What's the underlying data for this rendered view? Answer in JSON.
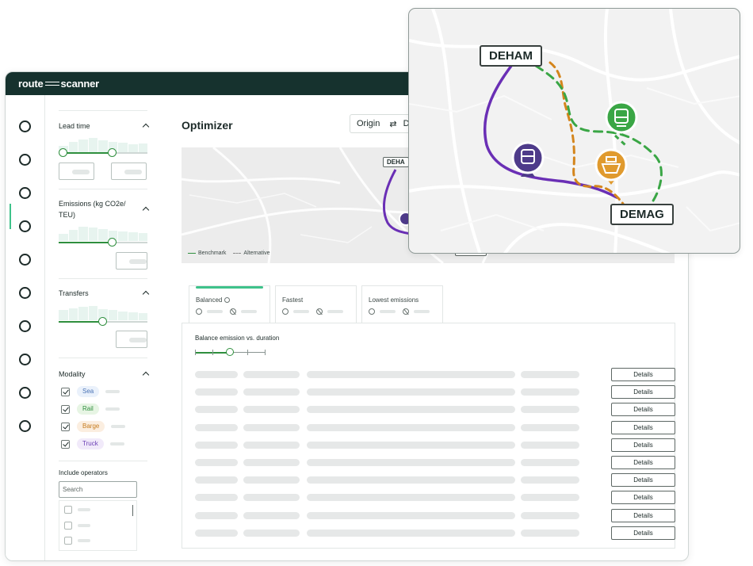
{
  "app": {
    "logo_left": "route",
    "logo_right": "scanner"
  },
  "filters": {
    "lead_time": "Lead time",
    "emissions": "Emissions (kg CO2e/",
    "emissions_line2": "TEU)",
    "transfers": "Transfers",
    "modality": "Modality",
    "modalities": [
      {
        "label": "Sea",
        "checked": true,
        "color": "#eaf1fb",
        "text_color": "#4a73b5"
      },
      {
        "label": "Rail",
        "checked": true,
        "color": "#e7f5e4",
        "text_color": "#2f8f3e"
      },
      {
        "label": "Barge",
        "checked": true,
        "color": "#fbeee0",
        "text_color": "#c67c1e"
      },
      {
        "label": "Truck",
        "checked": true,
        "color": "#f1eafa",
        "text_color": "#6a3fb5"
      }
    ],
    "include_operators": "Include operators",
    "search_placeholder": "Search"
  },
  "main": {
    "title": "Optimizer",
    "origin_label": "Origin",
    "swap_icon": "⇄",
    "dest_partial": "D",
    "map_legend_benchmark": "Benchmark",
    "map_legend_alternative": "Alternative",
    "map_small_origin_tag": "DEHA",
    "map_small_dest_tag": "DEMAG"
  },
  "tabs": [
    {
      "label": "Balanced",
      "active": true,
      "info_icon": true
    },
    {
      "label": "Fastest",
      "active": false
    },
    {
      "label": "Lowest emissions",
      "active": false
    }
  ],
  "results": {
    "title": "Balance emission vs. duration",
    "details_label": "Details",
    "row_count": 10
  },
  "map_card": {
    "origin": "DEHAM",
    "destination": "DEMAG",
    "colors": {
      "truck_route": "#6a2fb5",
      "rail_route": "#3aa645",
      "barge_route": "#d4851c"
    },
    "icons": [
      "truck-pin-icon",
      "train-pin-icon",
      "ship-pin-icon"
    ]
  }
}
